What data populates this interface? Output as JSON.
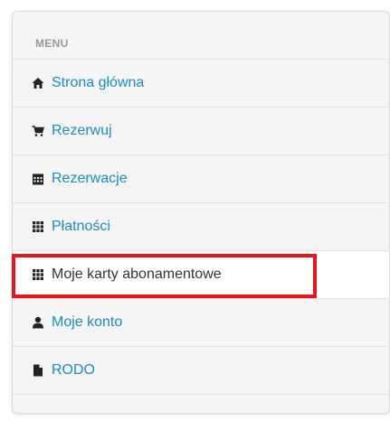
{
  "menu": {
    "header": "MENU",
    "items": [
      {
        "label": "Strona główna",
        "icon": "home-icon",
        "active": false
      },
      {
        "label": "Rezerwuj",
        "icon": "cart-icon",
        "active": false
      },
      {
        "label": "Rezerwacje",
        "icon": "calendar-icon",
        "active": false
      },
      {
        "label": "Płatności",
        "icon": "grid-icon",
        "active": false
      },
      {
        "label": "Moje karty abonamentowe",
        "icon": "grid-icon",
        "active": true
      },
      {
        "label": "Moje konto",
        "icon": "user-icon",
        "active": false
      },
      {
        "label": "RODO",
        "icon": "file-icon",
        "active": false
      }
    ]
  },
  "colors": {
    "link": "#1a8cc6",
    "active_text": "#333333",
    "highlight_border": "#e8141b",
    "panel_bg": "#f5f5f5"
  }
}
